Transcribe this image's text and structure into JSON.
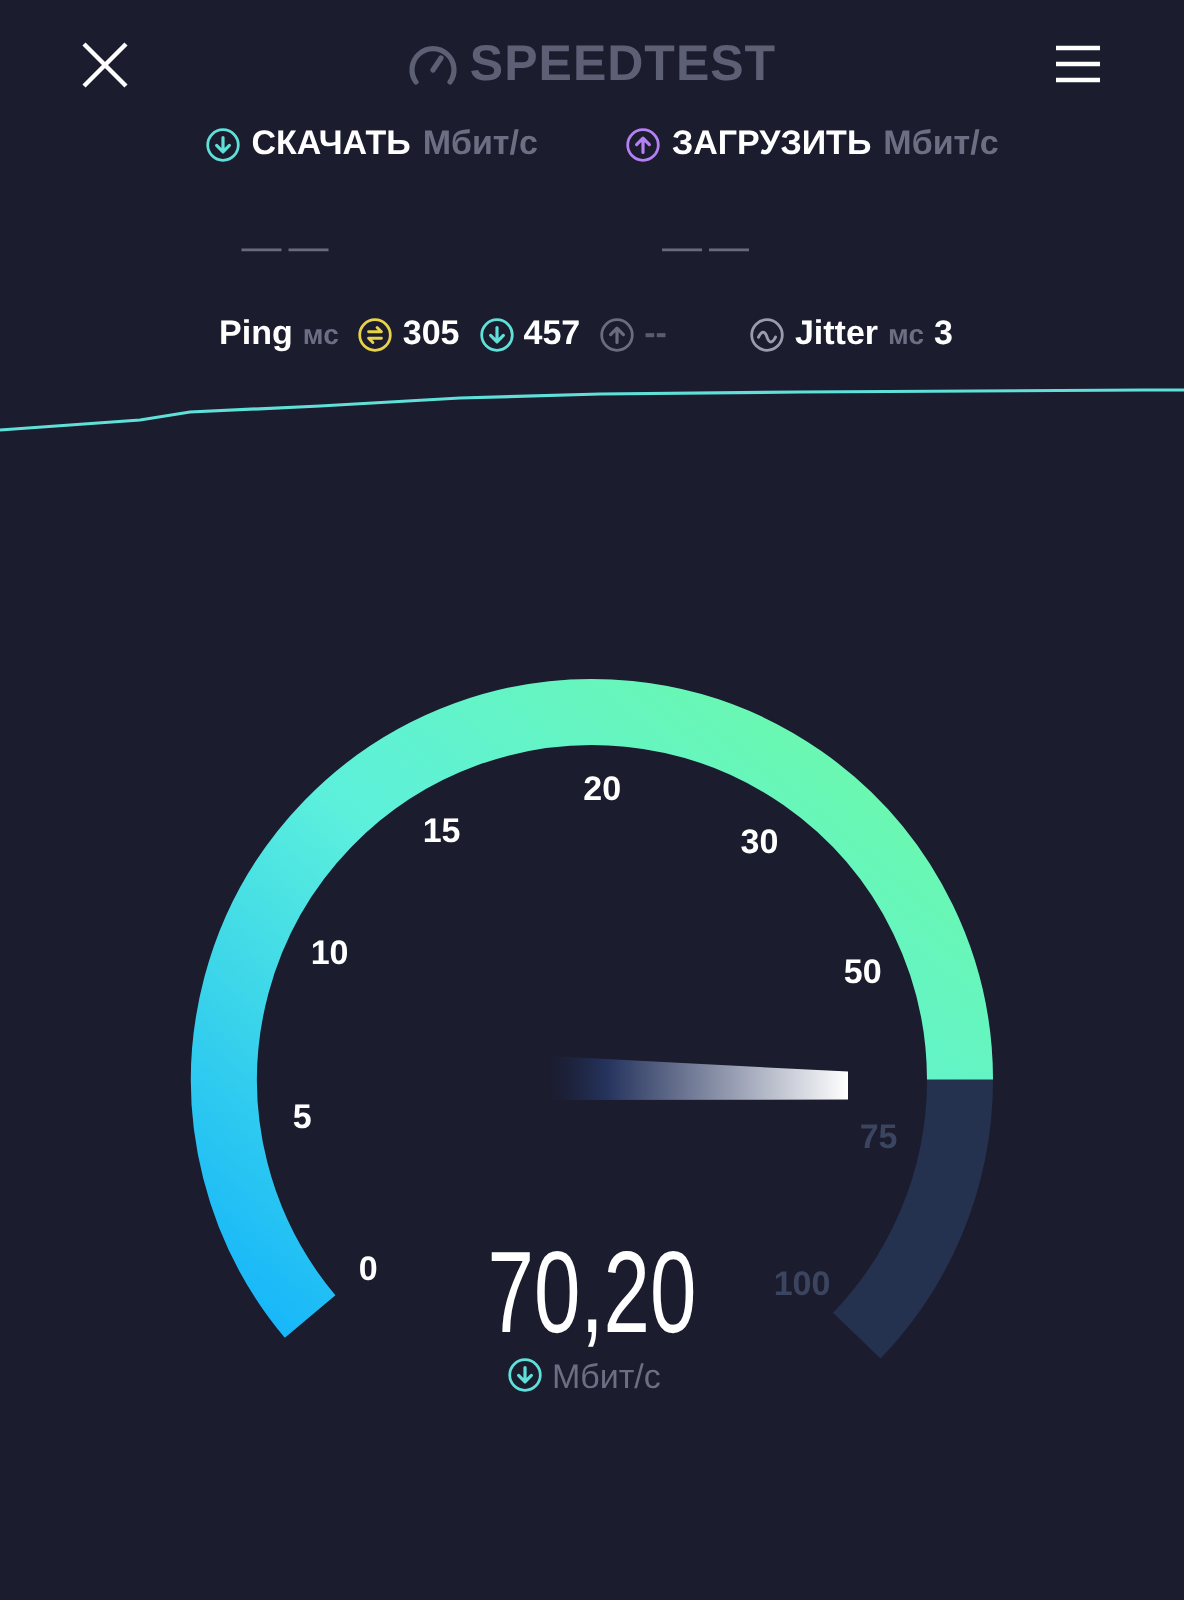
{
  "header": {
    "logo": "SPEEDTEST"
  },
  "results": [
    {
      "kind": "download",
      "label": "СКАЧАТЬ",
      "unit": "Мбит/с",
      "value": "— —"
    },
    {
      "kind": "upload",
      "label": "ЗАГРУЗИТЬ",
      "unit": "Мбит/с",
      "value": "— —"
    }
  ],
  "ping": {
    "label": "Ping",
    "unit": "мс",
    "items": [
      {
        "kind": "idle",
        "value": "305",
        "disabled": false
      },
      {
        "kind": "download",
        "value": "457",
        "disabled": false
      },
      {
        "kind": "upload",
        "value": "--",
        "disabled": true
      }
    ]
  },
  "jitter": {
    "label": "Jitter",
    "unit": "мс",
    "value": "3"
  },
  "gauge": {
    "ticks": [
      "0",
      "5",
      "10",
      "15",
      "20",
      "30",
      "50",
      "75",
      "100"
    ],
    "reading": "70,20",
    "unit": "Мбит/с"
  }
}
